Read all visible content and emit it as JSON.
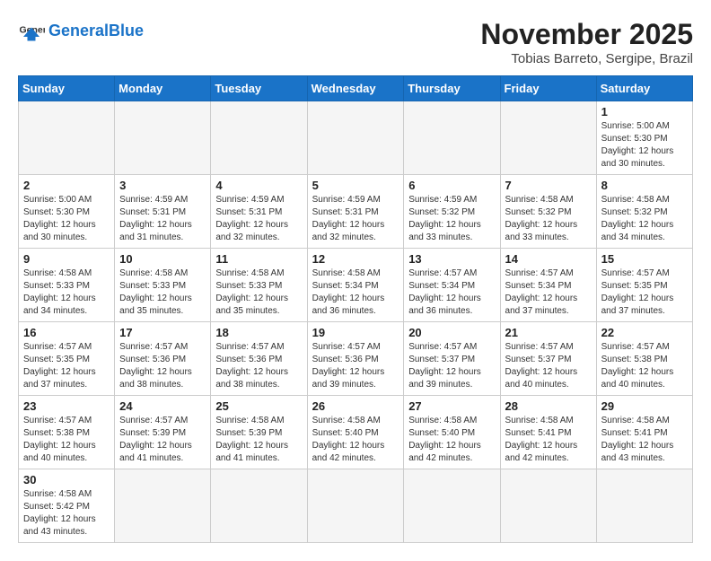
{
  "header": {
    "logo_text_normal": "General",
    "logo_text_blue": "Blue",
    "month": "November 2025",
    "location": "Tobias Barreto, Sergipe, Brazil"
  },
  "weekdays": [
    "Sunday",
    "Monday",
    "Tuesday",
    "Wednesday",
    "Thursday",
    "Friday",
    "Saturday"
  ],
  "days": {
    "d1": {
      "num": "1",
      "sunrise": "5:00 AM",
      "sunset": "5:30 PM",
      "daylight": "12 hours and 30 minutes."
    },
    "d2": {
      "num": "2",
      "sunrise": "5:00 AM",
      "sunset": "5:30 PM",
      "daylight": "12 hours and 30 minutes."
    },
    "d3": {
      "num": "3",
      "sunrise": "4:59 AM",
      "sunset": "5:31 PM",
      "daylight": "12 hours and 31 minutes."
    },
    "d4": {
      "num": "4",
      "sunrise": "4:59 AM",
      "sunset": "5:31 PM",
      "daylight": "12 hours and 32 minutes."
    },
    "d5": {
      "num": "5",
      "sunrise": "4:59 AM",
      "sunset": "5:31 PM",
      "daylight": "12 hours and 32 minutes."
    },
    "d6": {
      "num": "6",
      "sunrise": "4:59 AM",
      "sunset": "5:32 PM",
      "daylight": "12 hours and 33 minutes."
    },
    "d7": {
      "num": "7",
      "sunrise": "4:58 AM",
      "sunset": "5:32 PM",
      "daylight": "12 hours and 33 minutes."
    },
    "d8": {
      "num": "8",
      "sunrise": "4:58 AM",
      "sunset": "5:32 PM",
      "daylight": "12 hours and 34 minutes."
    },
    "d9": {
      "num": "9",
      "sunrise": "4:58 AM",
      "sunset": "5:33 PM",
      "daylight": "12 hours and 34 minutes."
    },
    "d10": {
      "num": "10",
      "sunrise": "4:58 AM",
      "sunset": "5:33 PM",
      "daylight": "12 hours and 35 minutes."
    },
    "d11": {
      "num": "11",
      "sunrise": "4:58 AM",
      "sunset": "5:33 PM",
      "daylight": "12 hours and 35 minutes."
    },
    "d12": {
      "num": "12",
      "sunrise": "4:58 AM",
      "sunset": "5:34 PM",
      "daylight": "12 hours and 36 minutes."
    },
    "d13": {
      "num": "13",
      "sunrise": "4:57 AM",
      "sunset": "5:34 PM",
      "daylight": "12 hours and 36 minutes."
    },
    "d14": {
      "num": "14",
      "sunrise": "4:57 AM",
      "sunset": "5:34 PM",
      "daylight": "12 hours and 37 minutes."
    },
    "d15": {
      "num": "15",
      "sunrise": "4:57 AM",
      "sunset": "5:35 PM",
      "daylight": "12 hours and 37 minutes."
    },
    "d16": {
      "num": "16",
      "sunrise": "4:57 AM",
      "sunset": "5:35 PM",
      "daylight": "12 hours and 37 minutes."
    },
    "d17": {
      "num": "17",
      "sunrise": "4:57 AM",
      "sunset": "5:36 PM",
      "daylight": "12 hours and 38 minutes."
    },
    "d18": {
      "num": "18",
      "sunrise": "4:57 AM",
      "sunset": "5:36 PM",
      "daylight": "12 hours and 38 minutes."
    },
    "d19": {
      "num": "19",
      "sunrise": "4:57 AM",
      "sunset": "5:36 PM",
      "daylight": "12 hours and 39 minutes."
    },
    "d20": {
      "num": "20",
      "sunrise": "4:57 AM",
      "sunset": "5:37 PM",
      "daylight": "12 hours and 39 minutes."
    },
    "d21": {
      "num": "21",
      "sunrise": "4:57 AM",
      "sunset": "5:37 PM",
      "daylight": "12 hours and 40 minutes."
    },
    "d22": {
      "num": "22",
      "sunrise": "4:57 AM",
      "sunset": "5:38 PM",
      "daylight": "12 hours and 40 minutes."
    },
    "d23": {
      "num": "23",
      "sunrise": "4:57 AM",
      "sunset": "5:38 PM",
      "daylight": "12 hours and 40 minutes."
    },
    "d24": {
      "num": "24",
      "sunrise": "4:57 AM",
      "sunset": "5:39 PM",
      "daylight": "12 hours and 41 minutes."
    },
    "d25": {
      "num": "25",
      "sunrise": "4:58 AM",
      "sunset": "5:39 PM",
      "daylight": "12 hours and 41 minutes."
    },
    "d26": {
      "num": "26",
      "sunrise": "4:58 AM",
      "sunset": "5:40 PM",
      "daylight": "12 hours and 42 minutes."
    },
    "d27": {
      "num": "27",
      "sunrise": "4:58 AM",
      "sunset": "5:40 PM",
      "daylight": "12 hours and 42 minutes."
    },
    "d28": {
      "num": "28",
      "sunrise": "4:58 AM",
      "sunset": "5:41 PM",
      "daylight": "12 hours and 42 minutes."
    },
    "d29": {
      "num": "29",
      "sunrise": "4:58 AM",
      "sunset": "5:41 PM",
      "daylight": "12 hours and 43 minutes."
    },
    "d30": {
      "num": "30",
      "sunrise": "4:58 AM",
      "sunset": "5:42 PM",
      "daylight": "12 hours and 43 minutes."
    }
  }
}
